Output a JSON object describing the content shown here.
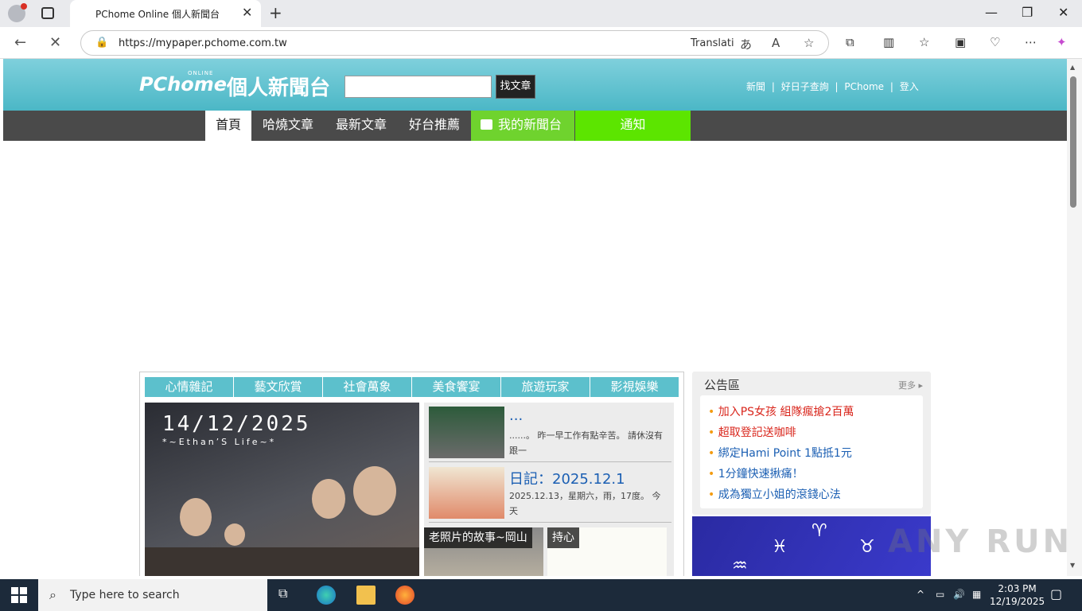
{
  "browser": {
    "tab_title": "PChome Online 個人新聞台",
    "url": "https://mypaper.pchome.com.tw",
    "translate_label": "Translati"
  },
  "site": {
    "logo": "PChome",
    "logo_online": "ONLINE",
    "logo_sub": "個人新聞台",
    "search_button": "找文章",
    "top_links": [
      "新聞",
      "好日子查詢",
      "PChome",
      "登入"
    ],
    "nav": [
      "首頁",
      "哈燒文章",
      "最新文章",
      "好台推薦",
      "我的新聞台",
      "通知"
    ]
  },
  "categories": [
    "心情雜記",
    "藝文欣賞",
    "社會萬象",
    "美食饗宴",
    "旅遊玩家",
    "影視娛樂"
  ],
  "feature": {
    "date_text": "14/12/2025",
    "subtitle": "*~Ethan’S Life~*"
  },
  "posts": [
    {
      "title": "...",
      "excerpt": "......。 昨一早工作有點辛苦。 請休沒有跟一"
    },
    {
      "title": "日記：2025.12.1",
      "excerpt": "2025.12.13，星期六，雨，17度。 今天"
    }
  ],
  "tiles": [
    {
      "label": "老照片的故事~岡山"
    },
    {
      "label": "持心"
    }
  ],
  "notice": {
    "title": "公告區",
    "more": "更多",
    "items": [
      {
        "text": "加入PS女孩 組隊瘋搶2百萬",
        "color": "#d9261c"
      },
      {
        "text": "超取登記送咖啡",
        "color": "#d9261c"
      },
      {
        "text": "綁定Hami Point 1點抵1元",
        "color": "#1b5fb3"
      },
      {
        "text": "1分鐘快速揪痛！",
        "color": "#1b5fb3"
      },
      {
        "text": "成為獨立小姐的滾錢心法",
        "color": "#1b5fb3"
      }
    ]
  },
  "watermark": "ANY RUN",
  "taskbar": {
    "search_placeholder": "Type here to search",
    "time": "2:03 PM",
    "date": "12/19/2025"
  },
  "colors": {
    "header": "#4bb7c6",
    "navbar": "#4a4a4a",
    "nav_green": "#6fd32e"
  }
}
